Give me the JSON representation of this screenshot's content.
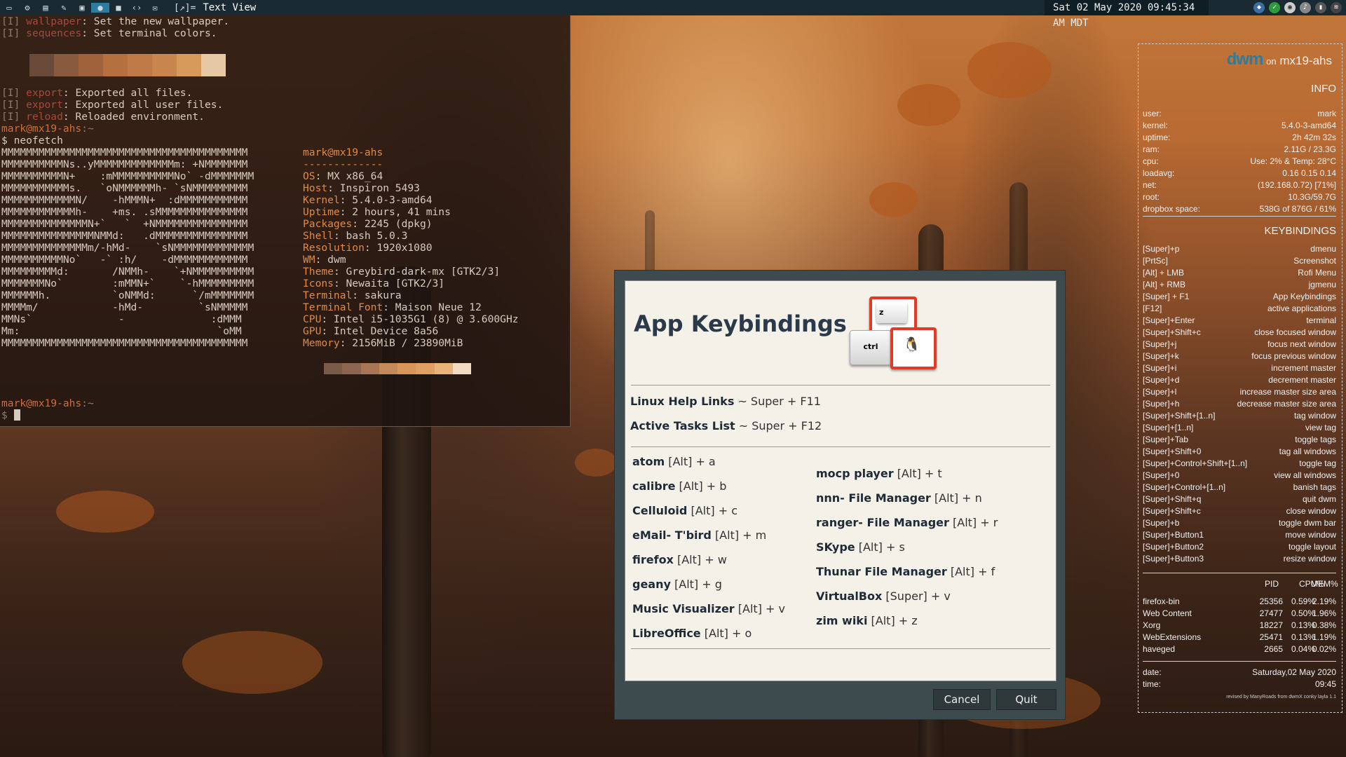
{
  "topbar": {
    "icons": [
      "window-icon",
      "settings-icon",
      "file-icon",
      "edit-icon",
      "image-icon",
      "mic-icon",
      "camera-icon",
      "code-icon",
      "mail-icon"
    ],
    "layout": "[↗]=",
    "window_title": "Text View",
    "clock": "Sat 02 May 2020 09:45:34 AM MDT"
  },
  "terminal": {
    "lines_top": [
      {
        "tag": "[I] ",
        "key": "wallpaper",
        "text": ": Set the new wallpaper."
      },
      {
        "tag": "[I] ",
        "key": "sequences",
        "text": ": Set terminal colors."
      }
    ],
    "lines_mid": [
      {
        "tag": "[I] ",
        "key": "export",
        "text": ": Exported all files."
      },
      {
        "tag": "[I] ",
        "key": "export",
        "text": ": Exported all user files."
      },
      {
        "tag": "[I] ",
        "key": "reload",
        "text": ": Reloaded environment."
      }
    ],
    "prompt": "mark@mx19-ahs",
    "prompt_suffix": ":~",
    "command": "$ neofetch",
    "prompt2": "mark@mx19-ahs",
    "prompt2_suffix": ":~",
    "dollar": "$ ",
    "ascii": [
      "MMMMMMMMMMMMMMMMMMMMMMMMMMMMMMMMMMMMMMMM",
      "MMMMMMMMMMNs..yMMMMMMMMMMMMMm: +NMMMMMMM",
      "MMMMMMMMMMN+    :mMMMMMMMMMMNo` -dMMMMMMM",
      "MMMMMMMMMMMs.   `oNMMMMMMh- `sNMMMMMMMMM",
      "MMMMMMMMMMMMN/    -hMMMN+  :dMMMMMMMMMMM",
      "MMMMMMMMMMMMh-    +ms. .sMMMMMMMMMMMMMMM",
      "MMMMMMMMMMMMMMN+`   `  +NMMMMMMMMMMMMMMM",
      "MMMMMMMMMMMMMMMNMMd:   .dMMMMMMMMMMMMMMM",
      "MMMMMMMMMMMMMMm/-hMd-    `sNMMMMMMMMMMMMM",
      "MMMMMMMMMMNo`   -` :h/    -dMMMMMMMMMMMM",
      "MMMMMMMMMd:       /NMMh-    `+NMMMMMMMMMM",
      "MMMMMMMNo`        :mMMN+`    `-hMMMMMMMMM",
      "MMMMMMh.          `oNMMd:      `/mMMMMMMM",
      "MMMMm/            -hMd-         `sNMMMMM",
      "MMNs`              -              :dMMM",
      "Mm:                                `oMM",
      "MMMMMMMMMMMMMMMMMMMMMMMMMMMMMMMMMMMMMMMM"
    ],
    "header": "mark@mx19-ahs",
    "separator": "-------------",
    "info": [
      {
        "k": "OS",
        "v": ": MX x86_64"
      },
      {
        "k": "Host",
        "v": ": Inspiron 5493"
      },
      {
        "k": "Kernel",
        "v": ": 5.4.0-3-amd64"
      },
      {
        "k": "Uptime",
        "v": ": 2 hours, 41 mins"
      },
      {
        "k": "Packages",
        "v": ": 2245 (dpkg)"
      },
      {
        "k": "Shell",
        "v": ": bash 5.0.3"
      },
      {
        "k": "Resolution",
        "v": ": 1920x1080"
      },
      {
        "k": "WM",
        "v": ": dwm"
      },
      {
        "k": "Theme",
        "v": ": Greybird-dark-mx [GTK2/3]"
      },
      {
        "k": "Icons",
        "v": ": Newaita [GTK2/3]"
      },
      {
        "k": "Terminal",
        "v": ": sakura"
      },
      {
        "k": "Terminal Font",
        "v": ": Maison Neue 12"
      },
      {
        "k": "CPU",
        "v": ": Intel i5-1035G1 (8) @ 3.600GHz"
      },
      {
        "k": "GPU",
        "v": ": Intel Device 8a56"
      },
      {
        "k": "Memory",
        "v": ": 2156MiB / 23890MiB"
      }
    ],
    "palette1": [
      "#6a4a38",
      "#8a5a3e",
      "#a0623a",
      "#b5703f",
      "#c07a48",
      "#c8854e",
      "#d89a5a",
      "#e6c9a4"
    ],
    "palette2": [
      "#7a5a48",
      "#8c6650",
      "#a87654",
      "#c58a58",
      "#d89658",
      "#e0a060",
      "#e8b47a",
      "#f0dcc0"
    ]
  },
  "conky": {
    "logo": "dwm",
    "on": "on",
    "host": "mx19-ahs",
    "info_title": "INFO",
    "info": [
      {
        "k": "user:",
        "v": "mark"
      },
      {
        "k": "kernel:",
        "v": "5.4.0-3-amd64"
      },
      {
        "k": "uptime:",
        "v": "2h 42m 32s"
      },
      {
        "k": "ram:",
        "v": "2.11G / 23.3G"
      },
      {
        "k": "cpu:",
        "v": "Use: 2%      & Temp: 28°C"
      },
      {
        "k": "loadavg:",
        "v": "0.16 0.15 0.14"
      },
      {
        "k": "net:",
        "v": "(192.168.0.72) [71%]"
      },
      {
        "k": "root:",
        "v": "10.3G/59.7G"
      },
      {
        "k": "dropbox space:",
        "v": "538G of 876G / 61%"
      }
    ],
    "kb_title": "KEYBINDINGS",
    "keybindings": [
      {
        "k": "[Super]+p",
        "v": "dmenu"
      },
      {
        "k": "[PrtSc]",
        "v": "Screenshot"
      },
      {
        "k": "[Alt] + LMB",
        "v": "Rofi Menu"
      },
      {
        "k": "[Alt] + RMB",
        "v": "jgmenu"
      },
      {
        "k": "[Super] + F1",
        "v": "App Keybindings"
      },
      {
        "k": "[F12]",
        "v": "active applications"
      },
      {
        "k": "[Super]+Enter",
        "v": "terminal"
      },
      {
        "k": "[Super]+Shift+c",
        "v": "close focused window"
      },
      {
        "k": "[Super]+j",
        "v": "focus next window"
      },
      {
        "k": "[Super]+k",
        "v": "focus previous window"
      },
      {
        "k": "[Super]+i",
        "v": "increment master"
      },
      {
        "k": "[Super]+d",
        "v": "decrement master"
      },
      {
        "k": "[Super]+l",
        "v": "increase master size area"
      },
      {
        "k": "[Super]+h",
        "v": "decrease master size area"
      },
      {
        "k": "[Super]+Shift+[1..n]",
        "v": "tag window"
      },
      {
        "k": "[Super]+[1..n]",
        "v": "view tag"
      },
      {
        "k": "[Super]+Tab",
        "v": "toggle tags"
      },
      {
        "k": "[Super]+Shift+0",
        "v": "tag all windows"
      },
      {
        "k": "[Super]+Control+Shift+[1..n]",
        "v": "toggle tag"
      },
      {
        "k": "[Super]+0",
        "v": "view all windows"
      },
      {
        "k": "[Super]+Control+[1..n]",
        "v": "banish tags"
      },
      {
        "k": "[Super]+Shift+q",
        "v": "quit dwm"
      },
      {
        "k": "[Super]+Shift+c",
        "v": "close window"
      },
      {
        "k": "[Super]+b",
        "v": "toggle dwm bar"
      },
      {
        "k": "[Super]+Button1",
        "v": "move window"
      },
      {
        "k": "[Super]+Button2",
        "v": "toggle layout"
      },
      {
        "k": "[Super]+Button3",
        "v": "resize window"
      }
    ],
    "proc_header": {
      "pid": "PID",
      "cpu": "CPU%",
      "mem": "MEM%"
    },
    "processes": [
      {
        "name": "firefox-bin",
        "pid": "25356",
        "cpu": "0.59%",
        "mem": "2.19%"
      },
      {
        "name": "Web Content",
        "pid": "27477",
        "cpu": "0.50%",
        "mem": "1.96%"
      },
      {
        "name": "Xorg",
        "pid": "18227",
        "cpu": "0.13%",
        "mem": "0.38%"
      },
      {
        "name": "WebExtensions",
        "pid": "25471",
        "cpu": "0.13%",
        "mem": "1.19%"
      },
      {
        "name": "haveged",
        "pid": "2665",
        "cpu": "0.04%",
        "mem": "0.02%"
      }
    ],
    "date_label": "date:",
    "date": "Saturday,02 May 2020",
    "time_label": "time:",
    "time": "09:45",
    "credit": "revised by ManyRoads from dwmX conky layla 1.1"
  },
  "dialog": {
    "title": "App Keybindings",
    "key_z": "z",
    "key_ctrl": "ctrl",
    "top_links": [
      {
        "name": "Linux Help Links",
        "keys": "~ Super + F11"
      },
      {
        "name": "Active Tasks List",
        "keys": "~ Super + F12"
      }
    ],
    "left_apps": [
      {
        "name": "atom",
        "keys": "[Alt] + a"
      },
      {
        "name": "calibre",
        "keys": "[Alt] + b"
      },
      {
        "name": "Celluloid",
        "keys": "[Alt] + c"
      },
      {
        "name": "eMail- T'bird",
        "keys": "[Alt] + m"
      },
      {
        "name": "firefox",
        "keys": "[Alt] + w"
      },
      {
        "name": "geany",
        "keys": "[Alt] + g"
      },
      {
        "name": "Music Visualizer",
        "keys": "[Alt] + v"
      },
      {
        "name": "LibreOffice",
        "keys": "[Alt] + o"
      }
    ],
    "right_apps": [
      {
        "name": "mocp player",
        "keys": "[Alt] + t"
      },
      {
        "name": "nnn- File Manager",
        "keys": "[Alt] + n"
      },
      {
        "name": "ranger- File Manager",
        "keys": "[Alt] + r"
      },
      {
        "name": "SKype",
        "keys": "[Alt] + s"
      },
      {
        "name": "Thunar File Manager",
        "keys": "[Alt] + f"
      },
      {
        "name": "VirtualBox",
        "keys": "[Super] + v"
      },
      {
        "name": "zim wiki",
        "keys": "[Alt] + z"
      }
    ],
    "cancel_label": "Cancel",
    "quit_label": "Quit"
  }
}
